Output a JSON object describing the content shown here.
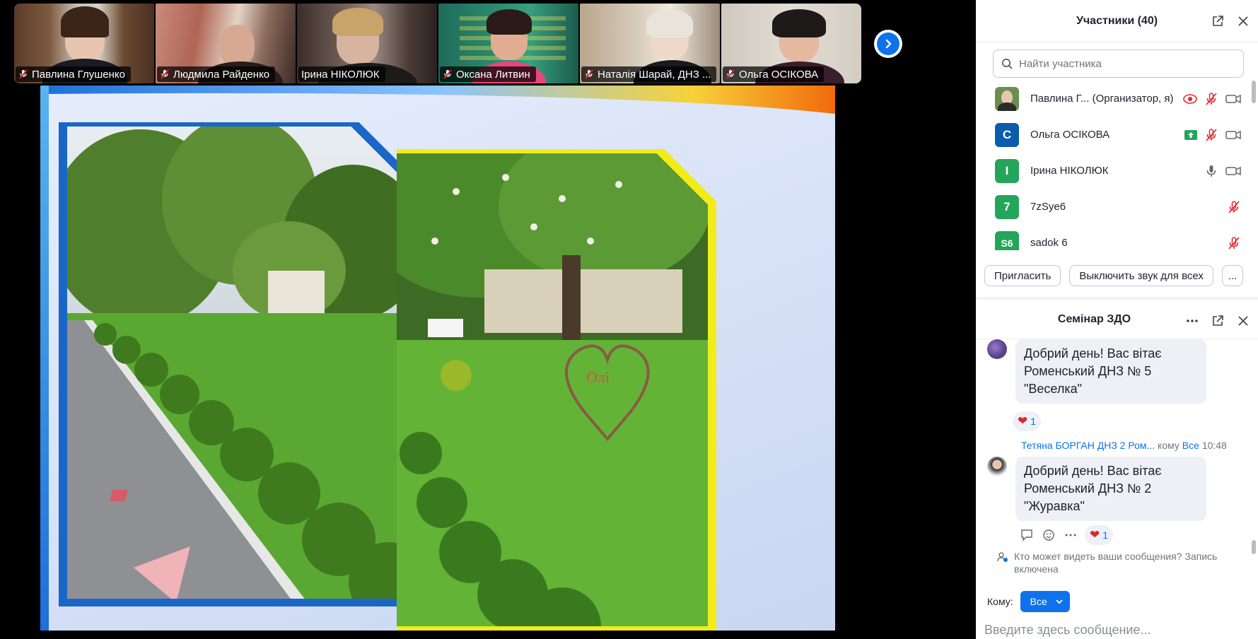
{
  "gallery": {
    "tiles": [
      {
        "name": "Павлина Глушенко",
        "muted": true
      },
      {
        "name": "Людмила Райденко",
        "muted": true
      },
      {
        "name": "Ірина НІКОЛЮК",
        "muted": false
      },
      {
        "name": "Оксана Литвин",
        "muted": true
      },
      {
        "name": "Наталія Шарай, ДНЗ ...",
        "muted": true
      },
      {
        "name": "Ольга ОСІКОВА",
        "muted": true
      }
    ],
    "active_tile": 2,
    "next_icon": "chevron-right-icon"
  },
  "shared_screen": {
    "slide_text_left": "",
    "heart_sign_text": "Олі"
  },
  "participants": {
    "title": "Участники (40)",
    "search_placeholder": "Найти участника",
    "list": [
      {
        "initial": "",
        "name": "Павлина Г...  (Организатор, я)",
        "avatar_color": "#6b8e4e",
        "status": [
          "record-icon",
          "mic-muted-icon",
          "video-icon"
        ]
      },
      {
        "initial": "С",
        "name": "Ольга ОСІКОВА",
        "avatar_color": "#0b5cad",
        "status": [
          "share-screen-icon",
          "mic-muted-icon",
          "video-icon"
        ]
      },
      {
        "initial": "І",
        "name": "Ірина НІКОЛЮК",
        "avatar_color": "#23a55a",
        "status": [
          "mic-icon",
          "video-icon"
        ]
      },
      {
        "initial": "7",
        "name": "7zSye6",
        "avatar_color": "#23a55a",
        "status": [
          "mic-muted-icon"
        ]
      },
      {
        "initial": "S6",
        "name": "sadok 6",
        "avatar_color": "#23a55a",
        "status": [
          "mic-muted-icon"
        ]
      }
    ],
    "buttons": {
      "invite": "Пригласить",
      "mute_all": "Выключить звук для всех",
      "more": "..."
    }
  },
  "chat": {
    "title": "Семінар ЗДО",
    "messages": [
      {
        "text": "Добрий день! Вас вітає Роменський ДНЗ № 5 \"Веселка\"",
        "reaction_count": "1"
      },
      {
        "sender": "Тетяна БОРГАН  ДНЗ 2 Ром...",
        "to_word": "кому",
        "to": "Все",
        "time": "10:48",
        "text": "Добрий день! Вас вітає Роменський ДНЗ № 2 \"Журавка\"",
        "reaction_count": "1"
      }
    ],
    "visibility_note": "Кто может видеть ваши сообщения? Запись включена",
    "to_label": "Кому:",
    "to_value": "Все",
    "input_placeholder": "Введите здесь сообщение..."
  },
  "colors": {
    "accent": "#0e72ed",
    "active_speaker": "#23d959",
    "muted_red": "#e0252b"
  }
}
